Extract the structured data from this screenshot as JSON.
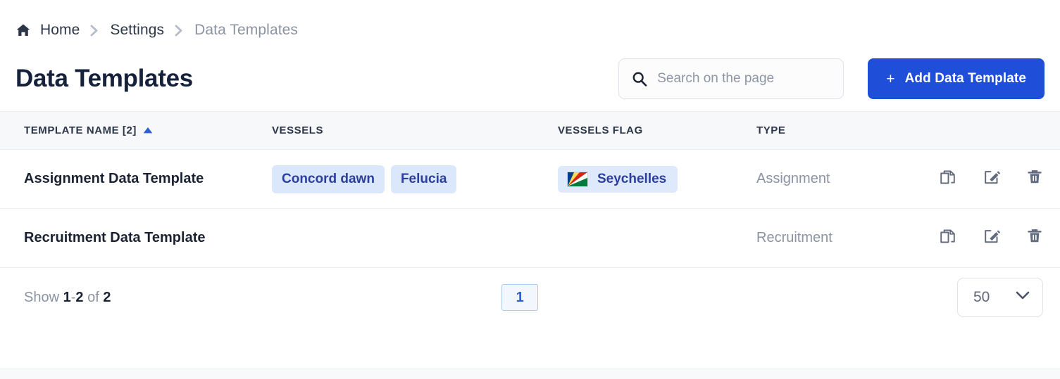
{
  "breadcrumb": {
    "items": [
      {
        "label": "Home",
        "icon": "home-icon",
        "current": false
      },
      {
        "label": "Settings",
        "current": false
      },
      {
        "label": "Data Templates",
        "current": true
      }
    ]
  },
  "header": {
    "title": "Data Templates",
    "search": {
      "placeholder": "Search on the page",
      "value": "",
      "icon": "search-icon"
    },
    "add_button": {
      "label": "Add Data Template",
      "icon": "plus-icon",
      "color": "#1f4fd8"
    }
  },
  "table": {
    "columns": [
      {
        "label": "TEMPLATE NAME [2]",
        "sorted": true,
        "sort_direction": "asc",
        "sort_color": "#2c5fd4"
      },
      {
        "label": "VESSELS"
      },
      {
        "label": "VESSELS FLAG"
      },
      {
        "label": "TYPE"
      }
    ],
    "rows": [
      {
        "name": "Assignment Data Template",
        "vessels": [
          "Concord dawn",
          "Felucia"
        ],
        "flags": [
          {
            "country": "Seychelles",
            "flag": "seychelles-flag-icon"
          }
        ],
        "type": "Assignment",
        "actions": [
          "copy-icon",
          "edit-icon",
          "delete-icon"
        ]
      },
      {
        "name": "Recruitment Data Template",
        "vessels": [],
        "flags": [],
        "type": "Recruitment",
        "actions": [
          "copy-icon",
          "edit-icon",
          "delete-icon"
        ]
      }
    ]
  },
  "footer": {
    "show_prefix": "Show",
    "range_start": "1",
    "range_dash": "-",
    "range_end": "2",
    "of_label": "of",
    "total": "2",
    "pages": [
      "1"
    ],
    "active_page": "1",
    "page_size": "50",
    "chevron": "chevron-down-icon"
  },
  "theme": {
    "accent": "#1f4fd8",
    "chip_bg": "#dbe7fb",
    "chip_text": "#2b3f9e",
    "muted_text": "#8b93a3",
    "header_bg": "#f7f8fa"
  }
}
